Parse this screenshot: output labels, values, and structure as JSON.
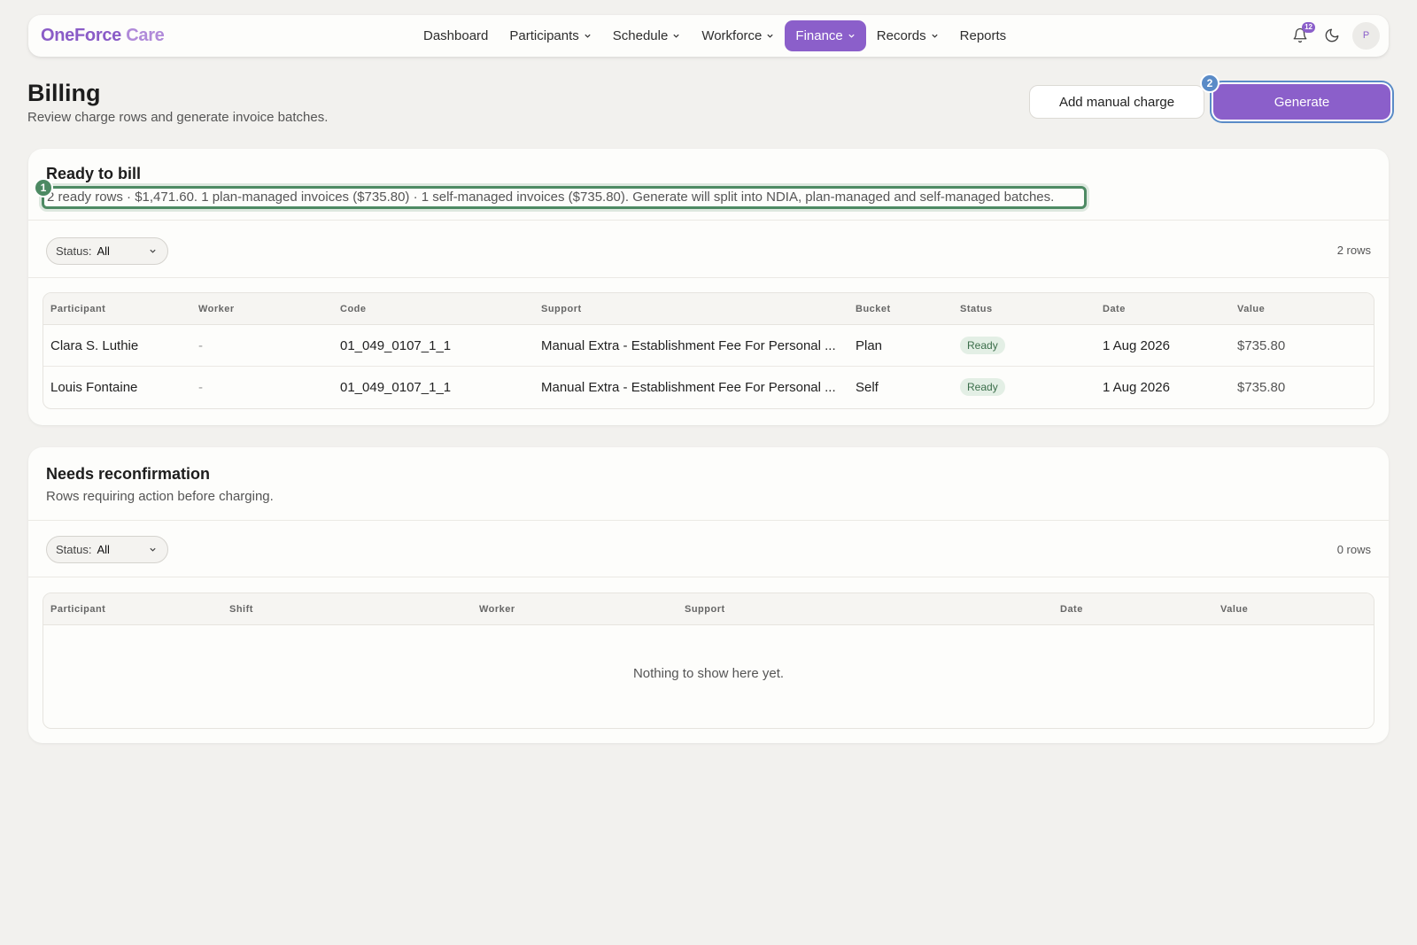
{
  "brand": {
    "part1": "OneForce",
    "part2": "Care"
  },
  "nav": {
    "items": [
      {
        "label": "Dashboard"
      },
      {
        "label": "Participants"
      },
      {
        "label": "Schedule"
      },
      {
        "label": "Workforce"
      },
      {
        "label": "Finance"
      },
      {
        "label": "Records"
      },
      {
        "label": "Reports"
      }
    ],
    "active": "Finance",
    "notifications_count": "12",
    "avatar_initial": "P"
  },
  "header": {
    "title": "Billing",
    "subtitle": "Review charge rows and generate invoice batches.",
    "add_manual_label": "Add manual charge",
    "generate_label": "Generate",
    "marker_generate": "2"
  },
  "ready": {
    "title": "Ready to bill",
    "summary": "2 ready rows · $1,471.60. 1 plan-managed invoices ($735.80) · 1 self-managed invoices ($735.80). Generate will split into NDIA, plan-managed and self-managed batches.",
    "marker_summary": "1",
    "filter_label": "Status:",
    "filter_value": "All",
    "row_count": "2 rows",
    "columns": [
      "Participant",
      "Worker",
      "Code",
      "Support",
      "Bucket",
      "Status",
      "Date",
      "Value"
    ],
    "rows": [
      {
        "participant": "Clara S. Luthie",
        "worker": "-",
        "code": "01_049_0107_1_1",
        "support": "Manual Extra - Establishment Fee For Personal ...",
        "bucket": "Plan",
        "status": "Ready",
        "date": "1 Aug 2026",
        "value": "$735.80"
      },
      {
        "participant": "Louis Fontaine",
        "worker": "-",
        "code": "01_049_0107_1_1",
        "support": "Manual Extra - Establishment Fee For Personal ...",
        "bucket": "Self",
        "status": "Ready",
        "date": "1 Aug 2026",
        "value": "$735.80"
      }
    ]
  },
  "reconfirm": {
    "title": "Needs reconfirmation",
    "subtitle": "Rows requiring action before charging.",
    "filter_label": "Status:",
    "filter_value": "All",
    "row_count": "0 rows",
    "columns": [
      "Participant",
      "Shift",
      "Worker",
      "Support",
      "Date",
      "Value"
    ],
    "empty": "Nothing to show here yet."
  },
  "colors": {
    "accent": "#8b5fca",
    "ready_green": "#4d8a63",
    "marker_blue": "#5a8bc7"
  }
}
